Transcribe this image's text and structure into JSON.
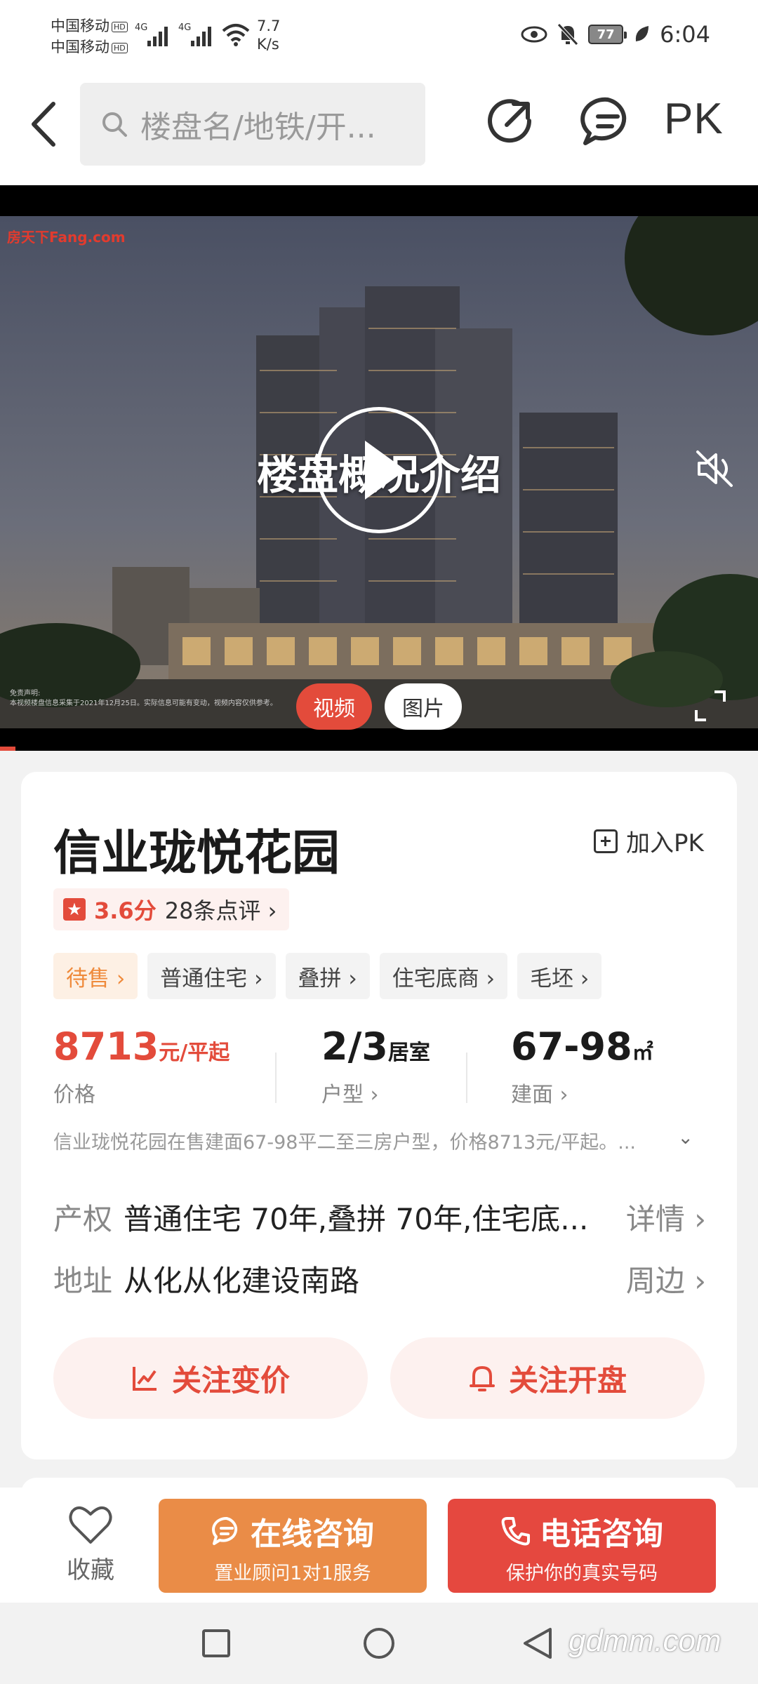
{
  "status_bar": {
    "carrier1": "中国移动",
    "carrier2": "中国移动",
    "hd": "HD",
    "net1": "4G",
    "net2": "4G",
    "speed_value": "7.7",
    "speed_unit": "K/s",
    "battery": "77",
    "time": "6:04"
  },
  "header": {
    "search_placeholder": "楼盘名/地铁/开...",
    "pk_label": "PK"
  },
  "hero": {
    "logo": "房天下Fang.com",
    "video_title": "楼盘概况介绍",
    "disclaimer_title": "免责声明:",
    "disclaimer_text": "本视频楼盘信息采集于2021年12月25日。实际信息可能有变动，视频内容仅供参考。",
    "tab_video": "视频",
    "tab_photo": "图片"
  },
  "property": {
    "name": "信业珑悦花园",
    "add_pk": "加入PK",
    "score": "3.6分",
    "reviews": "28条点评 ›",
    "tags": [
      "待售 ›",
      "普通住宅 ›",
      "叠拼 ›",
      "住宅底商 ›",
      "毛坯 ›"
    ],
    "price_value": "8713",
    "price_unit": "元/平起",
    "price_label": "价格",
    "layout_value": "2/3",
    "layout_unit": "居室",
    "layout_label": "户型 ›",
    "area_value": "67-98",
    "area_unit": "㎡",
    "area_label": "建面 ›",
    "summary": "信业珑悦花园在售建面67-98平二至三房户型，价格8713元/平起。...",
    "ownership_label": "产权",
    "ownership_value": "普通住宅 70年,叠拼 70年,住宅底...",
    "ownership_more": "详情 ›",
    "address_label": "地址",
    "address_value": "从化从化建设南路",
    "address_more": "周边 ›",
    "follow_price": "关注变价",
    "follow_open": "关注开盘"
  },
  "action_bar": {
    "favorite": "收藏",
    "online_title": "在线咨询",
    "online_sub": "置业顾问1对1服务",
    "phone_title": "电话咨询",
    "phone_sub": "保护你的真实号码"
  },
  "watermark": "gdmm.com",
  "colors": {
    "accent_red": "#e34b3b",
    "accent_orange": "#ea8c47"
  }
}
